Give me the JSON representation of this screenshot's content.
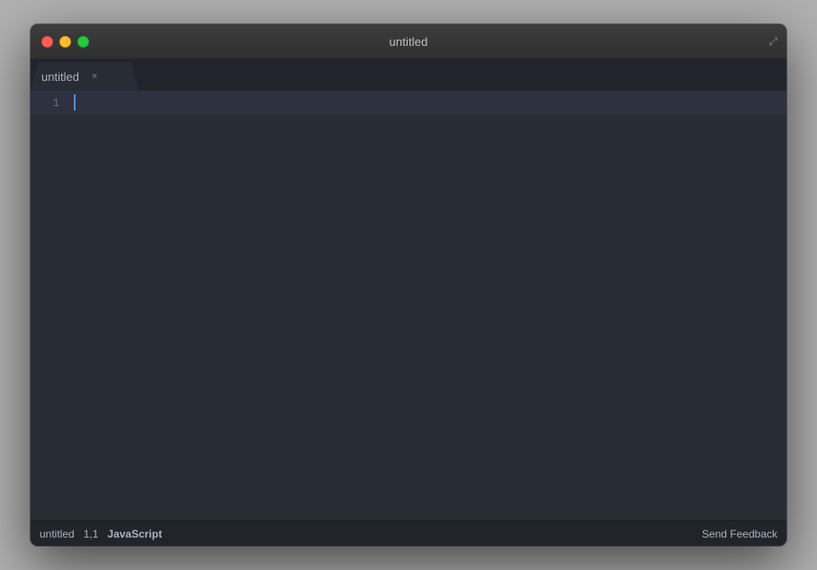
{
  "window": {
    "title": "untitled"
  },
  "titlebar": {
    "title": "untitled",
    "traffic_lights": {
      "close_label": "close",
      "minimize_label": "minimize",
      "maximize_label": "maximize"
    }
  },
  "tab": {
    "label": "untitled",
    "close_label": "×"
  },
  "editor": {
    "line_number": "1",
    "content": ""
  },
  "statusbar": {
    "filename": "untitled",
    "position": "1,1",
    "language": "JavaScript",
    "feedback": "Send Feedback"
  }
}
